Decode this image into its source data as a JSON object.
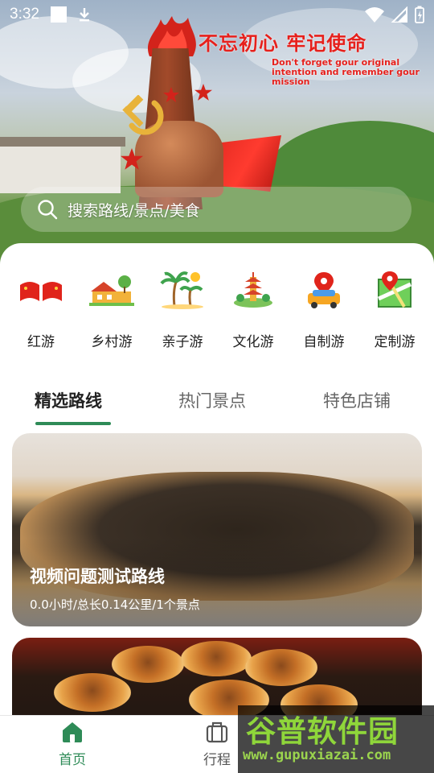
{
  "status_bar": {
    "time": "3:32"
  },
  "banner": {
    "slogan_cn": "不忘初心 牢记使命",
    "slogan_en": "Don't forget gour original intention and remember gour mission"
  },
  "search": {
    "placeholder": "搜索路线/景点/美食"
  },
  "categories": [
    {
      "label": "红游",
      "icon": "red-flags-icon"
    },
    {
      "label": "乡村游",
      "icon": "village-icon"
    },
    {
      "label": "亲子游",
      "icon": "palm-trees-icon"
    },
    {
      "label": "文化游",
      "icon": "pagoda-icon"
    },
    {
      "label": "自制游",
      "icon": "car-location-icon"
    },
    {
      "label": "定制游",
      "icon": "map-pin-icon"
    }
  ],
  "tabs": [
    {
      "label": "精选路线",
      "active": true
    },
    {
      "label": "热门景点",
      "active": false
    },
    {
      "label": "特色店铺",
      "active": false
    }
  ],
  "routes": [
    {
      "title": "视频问题测试路线",
      "meta": "0.0小时/总长0.14公里/1个景点"
    }
  ],
  "bottom_nav": [
    {
      "label": "首页",
      "icon": "home-icon",
      "active": true
    },
    {
      "label": "行程",
      "icon": "suitcase-icon",
      "active": false
    }
  ],
  "watermark": {
    "brand": "谷普软件园",
    "url": "www.gupuxiazai.com"
  },
  "colors": {
    "accent": "#2e8b57",
    "slogan": "#e6201c",
    "watermark": "#8fd63a"
  }
}
